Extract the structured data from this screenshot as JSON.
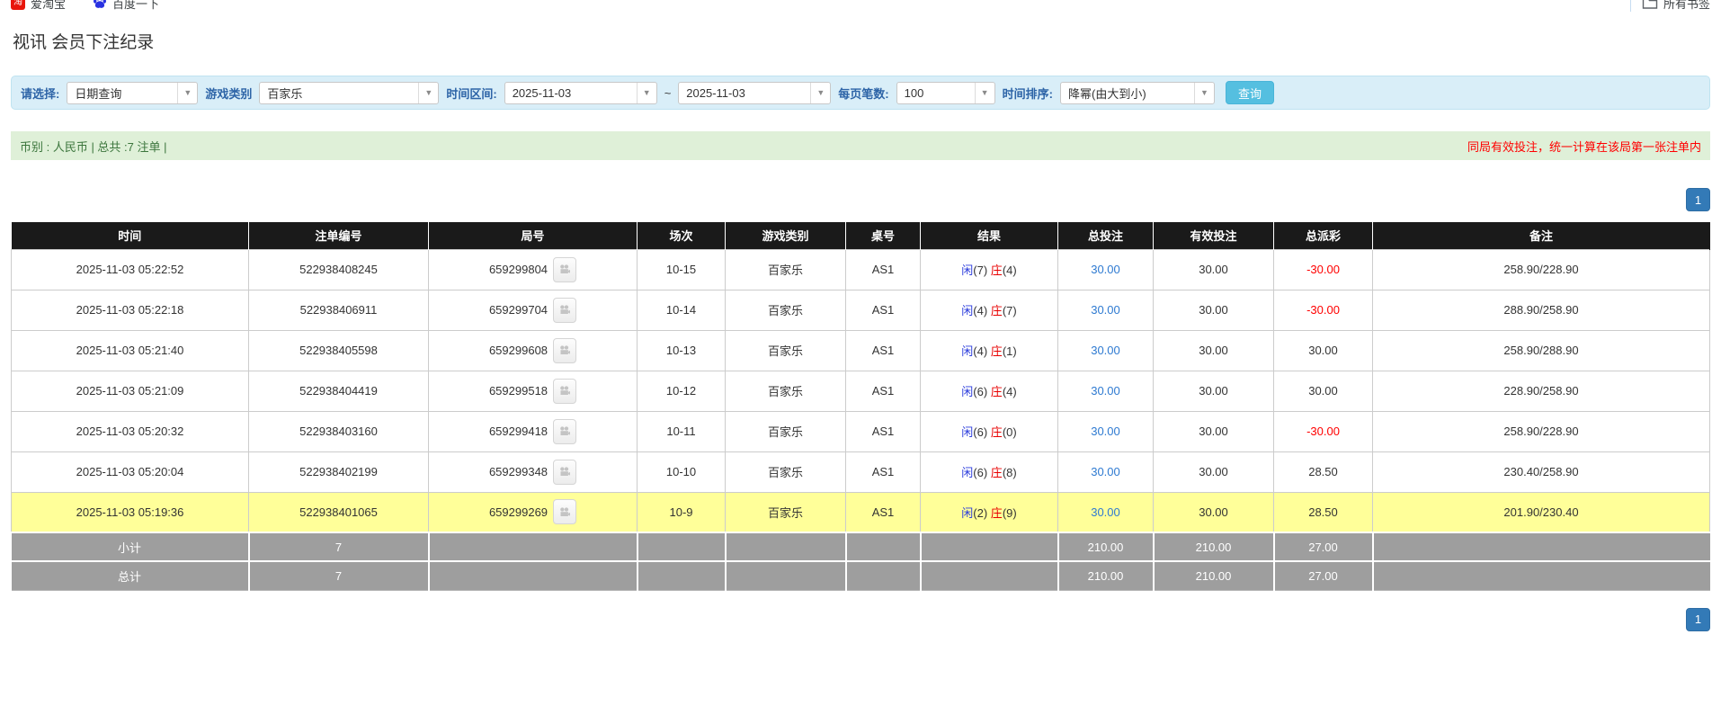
{
  "bookmarks": {
    "items": [
      {
        "label": "爱淘宝",
        "icon": "taobao-icon",
        "icon_glyph": "淘"
      },
      {
        "label": "百度一下",
        "icon": "baidu-icon"
      }
    ],
    "all_bookmarks_label": "所有书签"
  },
  "page": {
    "title": "视讯 会员下注纪录"
  },
  "filters": {
    "select_label": "请选择:",
    "select_value": "日期查询",
    "game_category_label": "游戏类别",
    "game_category_value": "百家乐",
    "time_range_label": "时间区间:",
    "date_from": "2025-11-03",
    "tilde": "~",
    "date_to": "2025-11-03",
    "page_size_label": "每页笔数:",
    "page_size_value": "100",
    "sort_label": "时间排序:",
    "sort_value": "降幂(由大到小)",
    "search_button": "查询"
  },
  "summary": {
    "left_text": "币别 : 人民币 | 总共 :7 注单 |",
    "right_text": "同局有效投注，统一计算在该局第一张注单内"
  },
  "pagination": {
    "page": "1"
  },
  "table": {
    "headers": [
      "时间",
      "注单编号",
      "局号",
      "场次",
      "游戏类别",
      "桌号",
      "结果",
      "总投注",
      "有效投注",
      "总派彩",
      "备注"
    ],
    "rows": [
      {
        "time": "2025-11-03 05:22:52",
        "bet_no": "522938408245",
        "round_no": "659299804",
        "session": "10-15",
        "game": "百家乐",
        "table_no": "AS1",
        "result": {
          "player_label": "闲",
          "player_score": "(7)",
          "banker_label": "庄",
          "banker_score": "(4)"
        },
        "total_bet": "30.00",
        "valid_bet": "30.00",
        "payout": "-30.00",
        "payout_negative": true,
        "note": "258.90/228.90",
        "highlighted": false
      },
      {
        "time": "2025-11-03 05:22:18",
        "bet_no": "522938406911",
        "round_no": "659299704",
        "session": "10-14",
        "game": "百家乐",
        "table_no": "AS1",
        "result": {
          "player_label": "闲",
          "player_score": "(4)",
          "banker_label": "庄",
          "banker_score": "(7)"
        },
        "total_bet": "30.00",
        "valid_bet": "30.00",
        "payout": "-30.00",
        "payout_negative": true,
        "note": "288.90/258.90",
        "highlighted": false
      },
      {
        "time": "2025-11-03 05:21:40",
        "bet_no": "522938405598",
        "round_no": "659299608",
        "session": "10-13",
        "game": "百家乐",
        "table_no": "AS1",
        "result": {
          "player_label": "闲",
          "player_score": "(4)",
          "banker_label": "庄",
          "banker_score": "(1)"
        },
        "total_bet": "30.00",
        "valid_bet": "30.00",
        "payout": "30.00",
        "payout_negative": false,
        "note": "258.90/288.90",
        "highlighted": false
      },
      {
        "time": "2025-11-03 05:21:09",
        "bet_no": "522938404419",
        "round_no": "659299518",
        "session": "10-12",
        "game": "百家乐",
        "table_no": "AS1",
        "result": {
          "player_label": "闲",
          "player_score": "(6)",
          "banker_label": "庄",
          "banker_score": "(4)"
        },
        "total_bet": "30.00",
        "valid_bet": "30.00",
        "payout": "30.00",
        "payout_negative": false,
        "note": "228.90/258.90",
        "highlighted": false
      },
      {
        "time": "2025-11-03 05:20:32",
        "bet_no": "522938403160",
        "round_no": "659299418",
        "session": "10-11",
        "game": "百家乐",
        "table_no": "AS1",
        "result": {
          "player_label": "闲",
          "player_score": "(6)",
          "banker_label": "庄",
          "banker_score": "(0)"
        },
        "total_bet": "30.00",
        "valid_bet": "30.00",
        "payout": "-30.00",
        "payout_negative": true,
        "note": "258.90/228.90",
        "highlighted": false
      },
      {
        "time": "2025-11-03 05:20:04",
        "bet_no": "522938402199",
        "round_no": "659299348",
        "session": "10-10",
        "game": "百家乐",
        "table_no": "AS1",
        "result": {
          "player_label": "闲",
          "player_score": "(6)",
          "banker_label": "庄",
          "banker_score": "(8)"
        },
        "total_bet": "30.00",
        "valid_bet": "30.00",
        "payout": "28.50",
        "payout_negative": false,
        "note": "230.40/258.90",
        "highlighted": false
      },
      {
        "time": "2025-11-03 05:19:36",
        "bet_no": "522938401065",
        "round_no": "659299269",
        "session": "10-9",
        "game": "百家乐",
        "table_no": "AS1",
        "result": {
          "player_label": "闲",
          "player_score": "(2)",
          "banker_label": "庄",
          "banker_score": "(9)"
        },
        "total_bet": "30.00",
        "valid_bet": "30.00",
        "payout": "28.50",
        "payout_negative": false,
        "note": "201.90/230.40",
        "highlighted": true
      }
    ],
    "footer": [
      {
        "label": "小计",
        "count": "7",
        "total_bet": "210.00",
        "valid_bet": "210.00",
        "payout": "27.00"
      },
      {
        "label": "总计",
        "count": "7",
        "total_bet": "210.00",
        "valid_bet": "210.00",
        "payout": "27.00"
      }
    ]
  },
  "colors": {
    "accent_blue_panel": "#d9eef8",
    "success_green_bar": "#dff0d8",
    "header_black": "#1a1a1a",
    "highlight_yellow": "#ffff99",
    "total_gray": "#9e9e9e",
    "pager_blue": "#337ab7",
    "search_btn_blue": "#55bfe0",
    "negative_red": "#ff0000",
    "player_blue": "#2b3cdc",
    "banker_red": "#e80000"
  }
}
